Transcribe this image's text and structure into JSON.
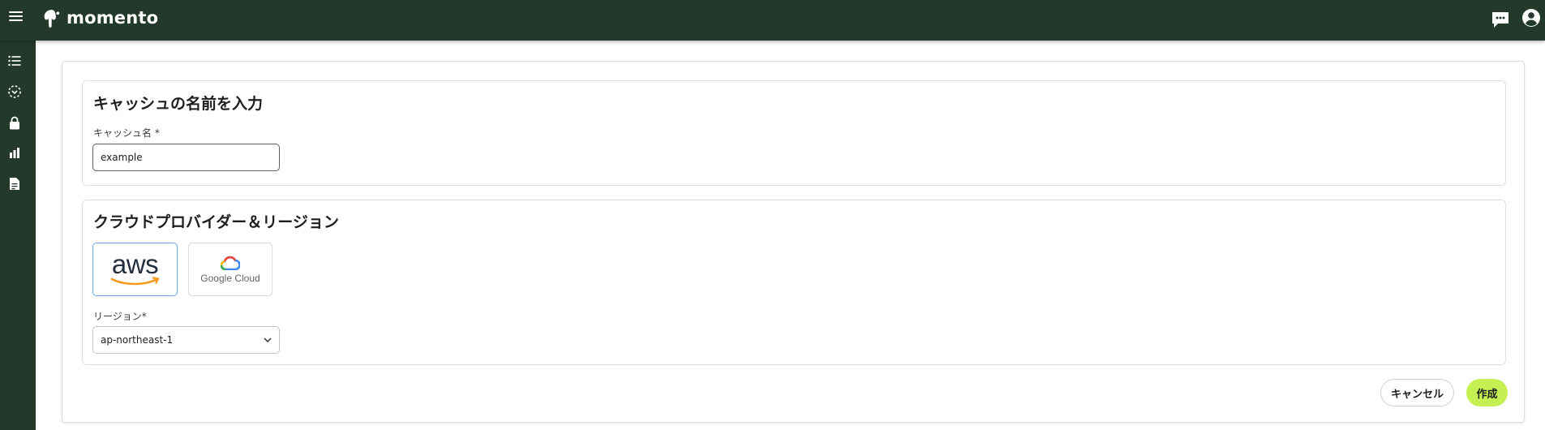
{
  "app": {
    "brand": "momento",
    "colors": {
      "nav_bg": "#22392b",
      "accent": "#c4f052",
      "selected_border": "#6aa6e0"
    }
  },
  "header": {
    "icons": [
      "menu-icon",
      "chat-icon",
      "account-icon"
    ]
  },
  "sidebar": {
    "items": [
      {
        "icon": "list-icon"
      },
      {
        "icon": "topics-icon"
      },
      {
        "icon": "lock-icon"
      },
      {
        "icon": "bar-chart-icon"
      },
      {
        "icon": "document-icon"
      }
    ]
  },
  "form": {
    "name_section": {
      "title": "キャッシュの名前を入力",
      "label": "キャッシュ名 *",
      "value": "example"
    },
    "provider_section": {
      "title": "クラウドプロバイダー＆リージョン",
      "providers": [
        {
          "name": "aws",
          "selected": true
        },
        {
          "name": "Google Cloud",
          "selected": false
        }
      ],
      "region_label": "リージョン*",
      "region_value": "ap-northeast-1"
    },
    "actions": {
      "cancel": "キャンセル",
      "create": "作成"
    }
  }
}
